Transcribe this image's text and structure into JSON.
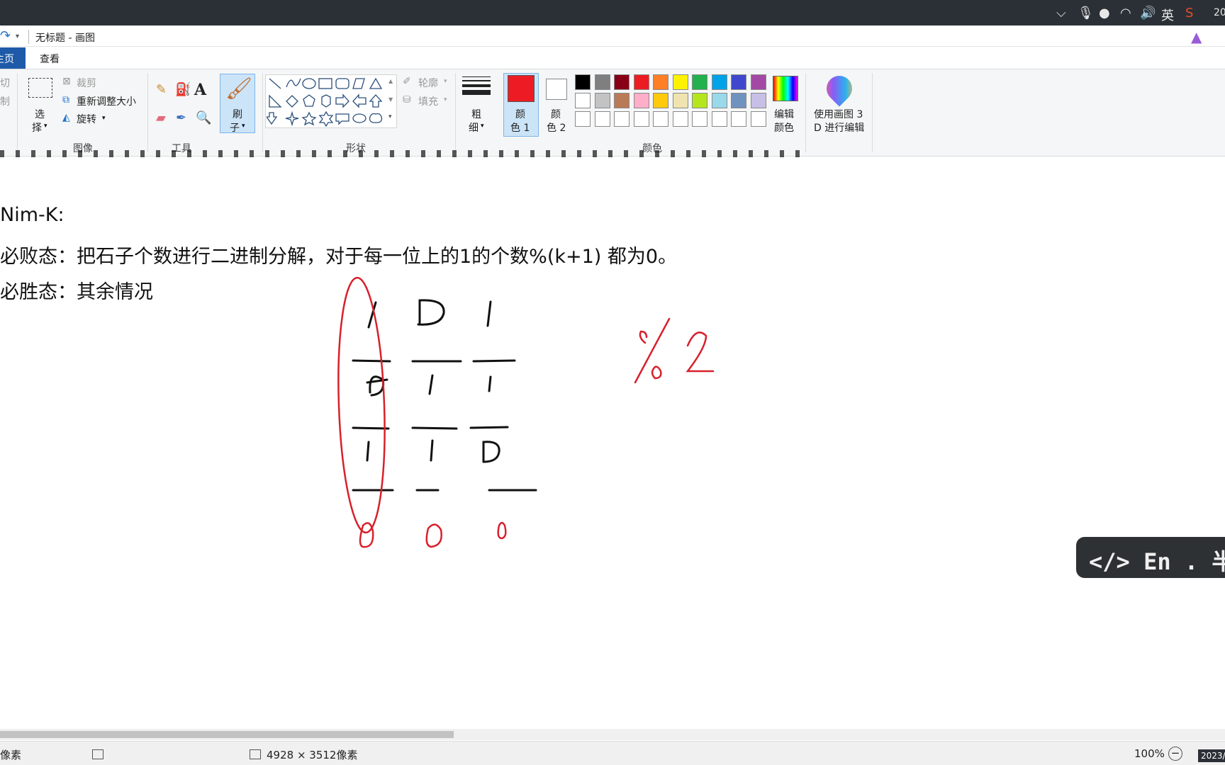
{
  "taskbar": {
    "ime_label": "英",
    "clock_partial": "20"
  },
  "window": {
    "title": "无标题 - 画图"
  },
  "tabs": {
    "home": "主页",
    "view": "查看"
  },
  "ribbon": {
    "clipboard": {
      "cut": "切",
      "copy": "制"
    },
    "image": {
      "select_line1": "选",
      "select_line2": "择",
      "crop": "裁剪",
      "resize": "重新调整大小",
      "rotate": "旋转",
      "group_label": "图像"
    },
    "tools": {
      "group_label": "工具",
      "text_icon": "A"
    },
    "brush": {
      "line1": "刷",
      "line2": "子"
    },
    "shapes": {
      "outline": "轮廓",
      "fill": "填充",
      "group_label": "形状"
    },
    "size": {
      "line1": "粗",
      "line2": "细"
    },
    "color1": {
      "line1": "颜",
      "line2": "色 1",
      "value": "#ed1c24"
    },
    "color2": {
      "line1": "颜",
      "line2": "色 2",
      "value": "#ffffff"
    },
    "colors": {
      "group_label": "颜色",
      "row1": [
        "#000000",
        "#7f7f7f",
        "#880015",
        "#ed1c24",
        "#ff7f27",
        "#fff200",
        "#22b14c",
        "#00a2e8",
        "#3f48cc",
        "#a349a4"
      ],
      "row2": [
        "#ffffff",
        "#c3c3c3",
        "#b97a57",
        "#ffaec9",
        "#ffc90e",
        "#efe4b0",
        "#b5e61d",
        "#99d9ea",
        "#7092be",
        "#c8bfe7"
      ],
      "row3": [
        "#ffffff",
        "#ffffff",
        "#ffffff",
        "#ffffff",
        "#ffffff",
        "#ffffff",
        "#ffffff",
        "#ffffff",
        "#ffffff",
        "#ffffff"
      ]
    },
    "edit_colors": {
      "line1": "编辑",
      "line2": "颜色"
    },
    "paint3d": {
      "line1": "使用画图 3",
      "line2": "D 进行编辑"
    }
  },
  "document": {
    "heading": "Nim-K:",
    "line_lose": "必败态：把石子个数进行二进制分解，对于每一位上的1的个数%(k+1) 都为0。",
    "line_win": "必胜态：其余情况"
  },
  "status": {
    "left_partial": "像素",
    "dimensions": "4928 × 3512像素",
    "zoom": "100%",
    "date_partial": "2023/"
  },
  "overlay": {
    "text": "</> En . 半"
  }
}
